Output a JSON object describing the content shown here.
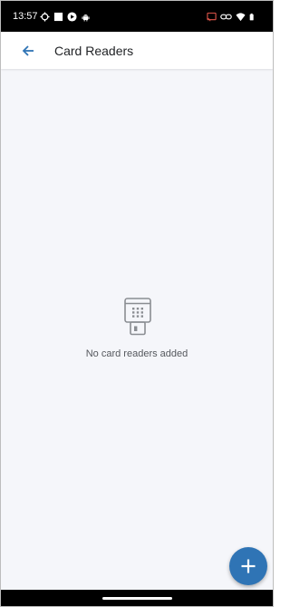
{
  "status_bar": {
    "time": "13:57",
    "left_icons": [
      "sync-icon",
      "square-icon",
      "play-icon",
      "android-icon"
    ],
    "right_icons": [
      "cast-icon",
      "link-icon",
      "wifi-icon",
      "battery-icon"
    ]
  },
  "app_bar": {
    "back_icon": "arrow-back-icon",
    "title": "Card Readers"
  },
  "empty_state": {
    "icon": "card-reader-icon",
    "message": "No card readers added"
  },
  "fab": {
    "icon": "plus-icon"
  },
  "colors": {
    "accent": "#2f74b5",
    "background": "#f5f6fa",
    "app_bar": "#ffffff",
    "status_bar": "#000000",
    "title_text": "#1f2124",
    "secondary_text": "#55585d",
    "empty_icon": "#8a8d92"
  }
}
